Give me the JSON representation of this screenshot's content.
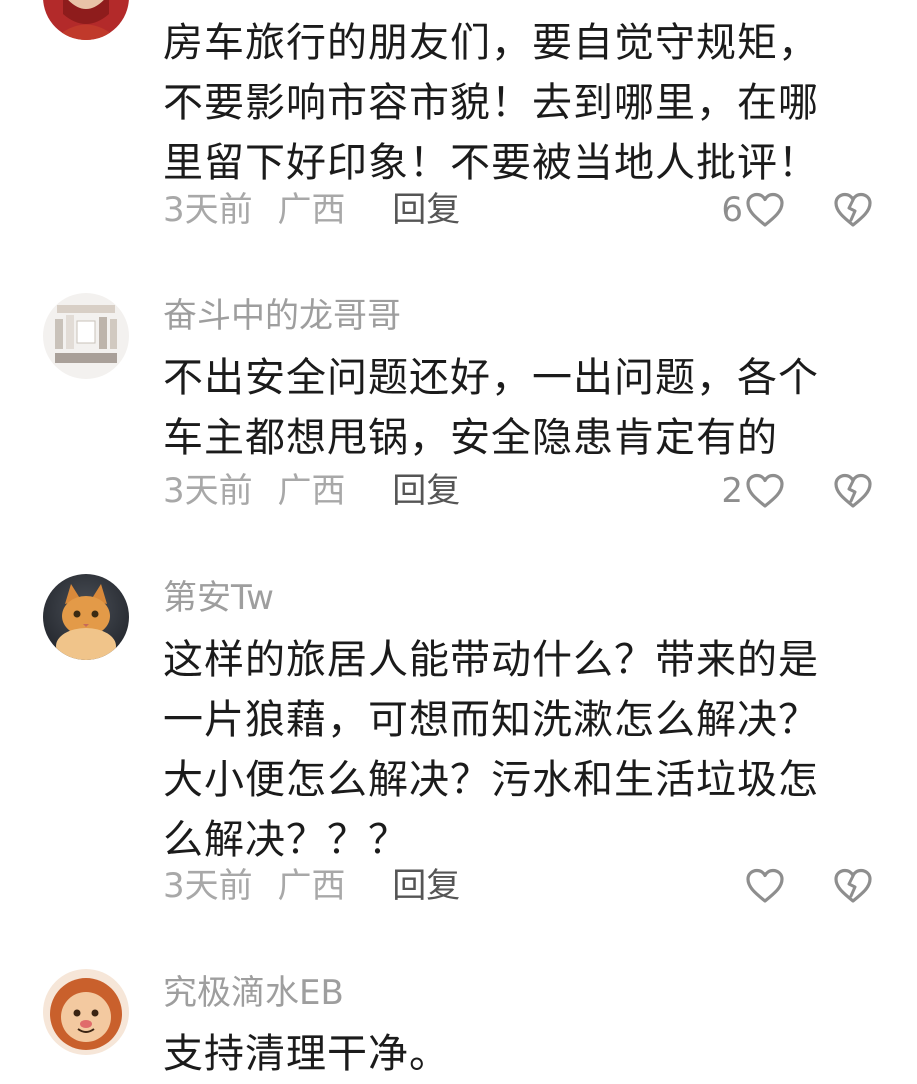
{
  "comments": [
    {
      "username": "",
      "avatar_icon": "person-photo-avatar",
      "lines": [
        "房车旅行的朋友们，要自觉守规矩，",
        "不要影响市容市貌！去到哪里，在哪",
        "里留下好印象！不要被当地人批评！"
      ],
      "time": "3天前",
      "region": "广西",
      "reply_label": "回复",
      "like_count": "6"
    },
    {
      "username": "奋斗中的龙哥哥",
      "avatar_icon": "product-photo-avatar",
      "lines": [
        "不出安全问题还好，一出问题，各个",
        "车主都想甩锅，安全隐患肯定有的"
      ],
      "time": "3天前",
      "region": "广西",
      "reply_label": "回复",
      "like_count": "2"
    },
    {
      "username": "第安Tw",
      "avatar_icon": "cat-photo-avatar",
      "lines": [
        "这样的旅居人能带动什么？带来的是",
        "一片狼藉，可想而知洗漱怎么解决？",
        "大小便怎么解决？污水和生活垃圾怎",
        "么解决？？？"
      ],
      "time": "3天前",
      "region": "广西",
      "reply_label": "回复",
      "like_count": ""
    },
    {
      "username": "究极滴水EB",
      "avatar_icon": "lion-cartoon-avatar",
      "lines": [
        "支持清理干净。"
      ]
    }
  ],
  "colors": {
    "username": "#9e9e9e",
    "body_text": "#1b1b1b",
    "meta": "#a8a8a8",
    "reply": "#555555",
    "icon": "#8e8e8e"
  }
}
